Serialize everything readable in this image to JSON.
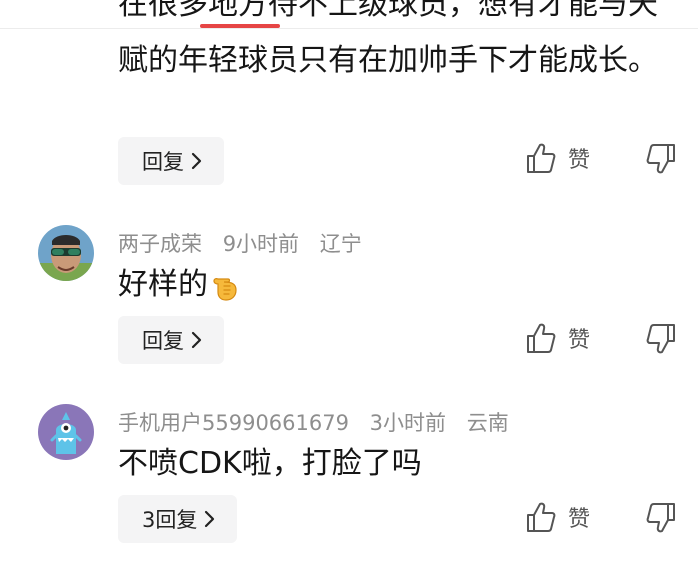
{
  "comments": [
    {
      "text_partial": "在很多地方待不上级球员，想有才能与天",
      "text": "赋的年轻球员只有在加帅手下才能成长。",
      "reply_label": "回复",
      "like_label": "赞"
    },
    {
      "username": "两子成荣",
      "time": "9小时前",
      "location": "辽宁",
      "text": "好样的",
      "emoji_name": "backhand-index-pointing-left",
      "reply_label": "回复",
      "like_label": "赞"
    },
    {
      "username": "手机用户55990661679",
      "time": "3小时前",
      "location": "云南",
      "text": "不喷CDK啦，打脸了吗",
      "reply_label": "3回复",
      "like_label": "赞"
    }
  ],
  "colors": {
    "accent": "#e64545",
    "meta_text": "#8e8e8e",
    "reply_bg": "#f4f4f5"
  }
}
